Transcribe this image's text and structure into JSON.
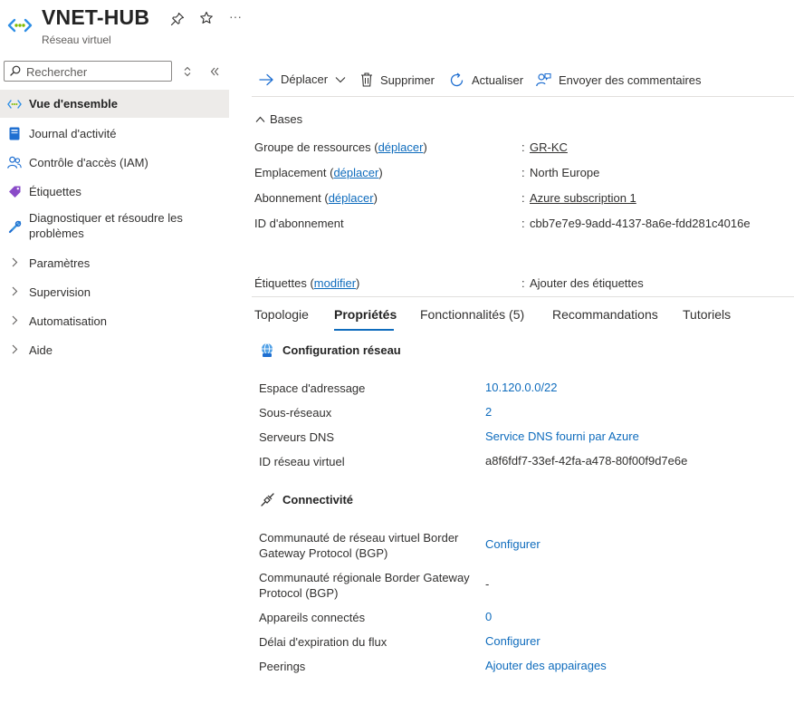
{
  "header": {
    "title": "VNET-HUB",
    "subtitle": "Réseau virtuel",
    "pin_icon": "pin-icon",
    "favorite_icon": "star-icon",
    "more_label": "···"
  },
  "sidebar": {
    "search_placeholder": "Rechercher",
    "items": [
      {
        "label": "Vue d'ensemble",
        "icon": "vnet-icon"
      },
      {
        "label": "Journal d'activité",
        "icon": "activity-log-icon"
      },
      {
        "label": "Contrôle d'accès (IAM)",
        "icon": "iam-people-icon"
      },
      {
        "label": "Étiquettes",
        "icon": "tag-icon"
      },
      {
        "label": "Diagnostiquer et résoudre les problèmes",
        "icon": "wrench-icon"
      },
      {
        "label": "Paramètres",
        "icon": "chevron-right-icon"
      },
      {
        "label": "Supervision",
        "icon": "chevron-right-icon"
      },
      {
        "label": "Automatisation",
        "icon": "chevron-right-icon"
      },
      {
        "label": "Aide",
        "icon": "chevron-right-icon"
      }
    ]
  },
  "toolbar": {
    "move": "Déplacer",
    "delete": "Supprimer",
    "refresh": "Actualiser",
    "feedback": "Envoyer des commentaires"
  },
  "essentials": {
    "heading": "Bases",
    "rows": [
      {
        "label": "Groupe de ressources",
        "action": "déplacer",
        "value": "GR-KC",
        "value_link": true
      },
      {
        "label": "Emplacement",
        "action": "déplacer",
        "value": "North Europe",
        "value_link": false
      },
      {
        "label": "Abonnement",
        "action": "déplacer",
        "value": "Azure subscription 1",
        "value_link": true
      },
      {
        "label": "ID d'abonnement",
        "action": "",
        "value": "cbb7e7e9-9add-4137-8a6e-fdd281c4016e",
        "value_link": false
      }
    ],
    "tags": {
      "label": "Étiquettes",
      "action": "modifier",
      "value": "Ajouter des étiquettes"
    }
  },
  "tabs": [
    "Topologie",
    "Propriétés",
    "Fonctionnalités (5)",
    "Recommandations",
    "Tutoriels"
  ],
  "selected_tab": "Propriétés",
  "network_config": {
    "heading": "Configuration réseau",
    "rows": [
      {
        "label": "Espace d'adressage",
        "value": "10.120.0.0/22"
      },
      {
        "label": "Sous-réseaux",
        "value": "2"
      },
      {
        "label": "Serveurs DNS",
        "value": "Service DNS fourni par Azure"
      },
      {
        "label": "ID réseau virtuel",
        "value": "a8f6fdf7-33ef-42fa-a478-80f00f9d7e6e"
      }
    ]
  },
  "connectivity": {
    "heading": "Connectivité",
    "rows": [
      {
        "label": "Communauté de réseau virtuel Border Gateway Protocol (BGP)",
        "value": "Configurer"
      },
      {
        "label": "Communauté régionale Border Gateway Protocol (BGP)",
        "value": "-"
      },
      {
        "label": "Appareils connectés",
        "value": "0"
      },
      {
        "label": "Délai d'expiration du flux",
        "value": "Configurer"
      },
      {
        "label": "Peerings",
        "value": "Ajouter des appairages"
      }
    ]
  },
  "colors": {
    "accent": "#0f6cbd",
    "selected_bg": "#edebe9",
    "text": "#323130"
  }
}
